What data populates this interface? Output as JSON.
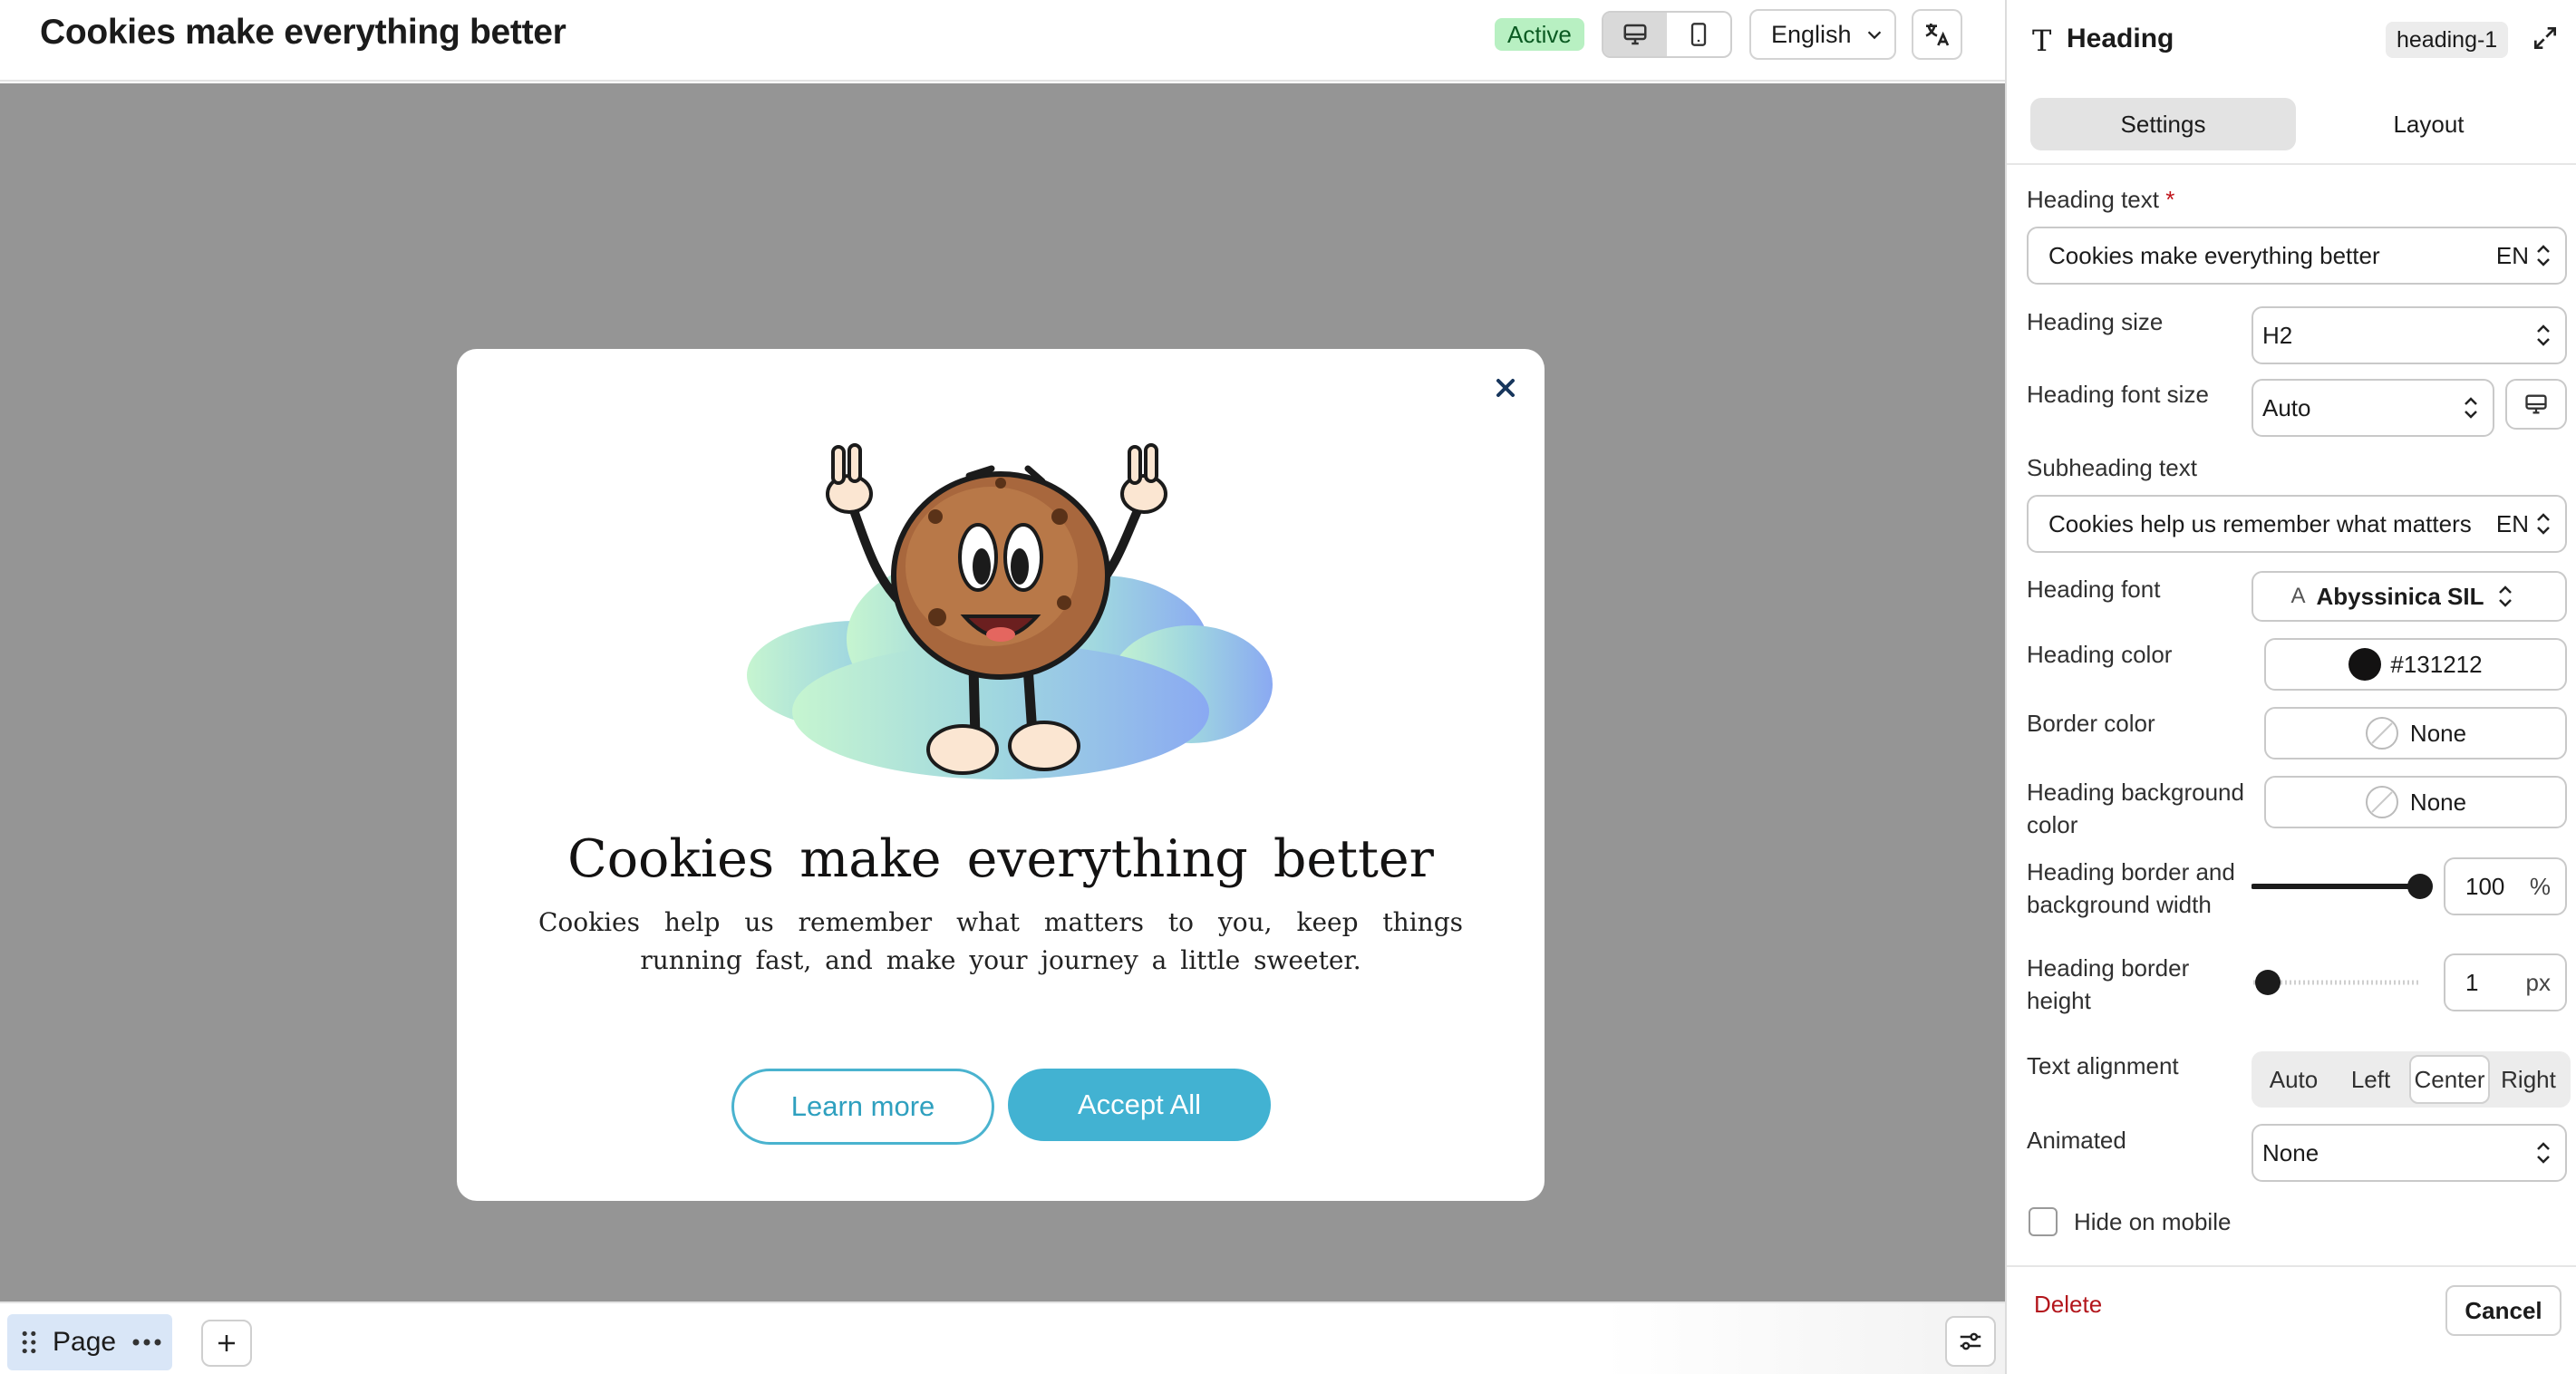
{
  "header": {
    "title": "Cookies make everything better",
    "status_badge": "Active",
    "language": "English"
  },
  "modal": {
    "heading": "Cookies make everything better",
    "subheading": "Cookies help us remember what matters to you, keep things running fast, and make your journey a little sweeter.",
    "learn_more_label": "Learn more",
    "accept_label": "Accept All"
  },
  "bottom": {
    "page_label": "Page"
  },
  "panel": {
    "title": "Heading",
    "element_id": "heading-1",
    "tabs": [
      {
        "label": "Settings",
        "active": true
      },
      {
        "label": "Layout",
        "active": false
      }
    ],
    "heading_text": {
      "label": "Heading text",
      "required_mark": "*",
      "value": "Cookies make everything better",
      "lang": "EN"
    },
    "heading_size": {
      "label": "Heading size",
      "value": "H2"
    },
    "heading_font_size": {
      "label": "Heading font size",
      "value": "Auto"
    },
    "subheading_text": {
      "label": "Subheading text",
      "value": "Cookies help us remember what matters to you, keep things running fast, and make your journey a little sweeter.",
      "lang": "EN"
    },
    "heading_font": {
      "label": "Heading font",
      "value": "Abyssinica SIL"
    },
    "heading_color": {
      "label": "Heading color",
      "value": "#131212"
    },
    "border_color": {
      "label": "Border color",
      "value": "None"
    },
    "heading_background_color": {
      "label": "Heading background color",
      "value": "None"
    },
    "border_bg_width": {
      "label": "Heading border and background width",
      "value": "100",
      "unit": "%",
      "fraction": 1.0
    },
    "border_height": {
      "label": "Heading border height",
      "value": "1",
      "unit": "px",
      "fraction": 0.0
    },
    "text_alignment": {
      "label": "Text alignment",
      "options": [
        "Auto",
        "Left",
        "Center",
        "Right"
      ],
      "selected": "Center"
    },
    "animated": {
      "label": "Animated",
      "value": "None"
    },
    "hide_on_mobile": {
      "label": "Hide on mobile",
      "checked": false
    },
    "delete_label": "Delete",
    "cancel_label": "Cancel"
  },
  "colors": {
    "accent": "#42b2d2",
    "badge_bg": "#b8f0c2",
    "heading_color": "#131212",
    "danger": "#b3161c"
  }
}
